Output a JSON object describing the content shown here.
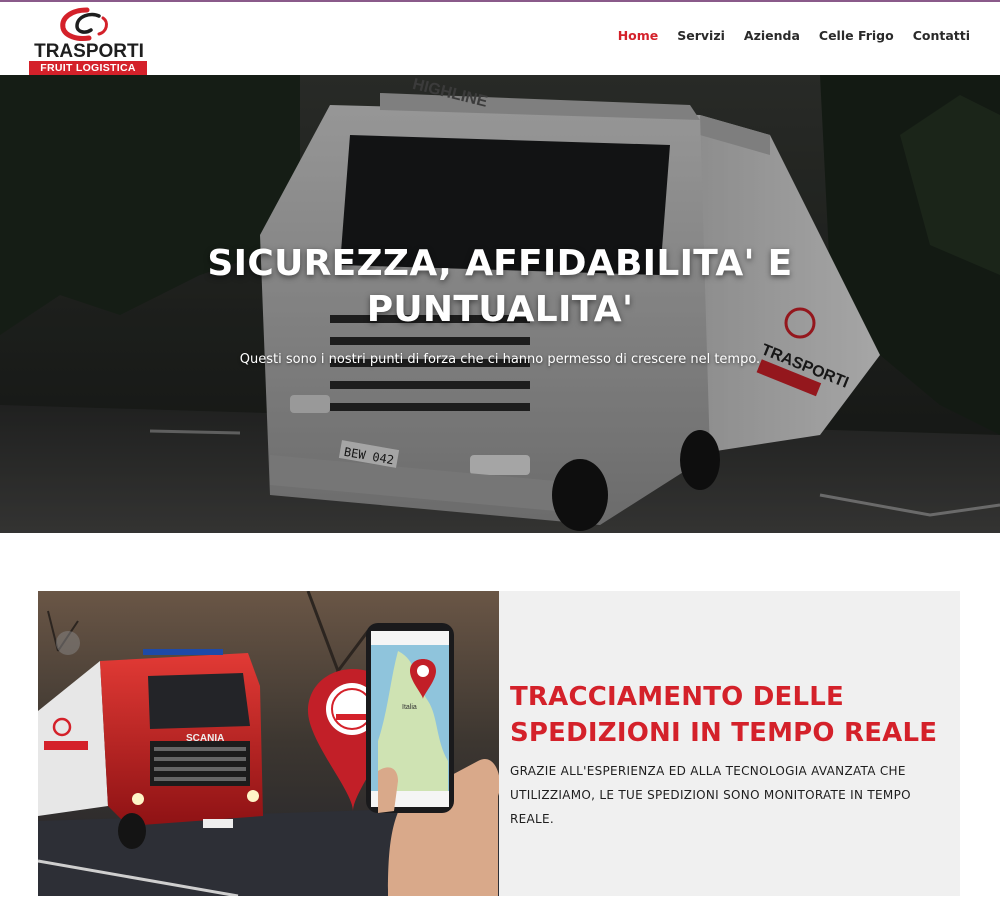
{
  "logo": {
    "wordmark": "TRASPORTI",
    "tagline": "FRUIT LOGISTICA"
  },
  "nav": {
    "items": [
      {
        "label": "Home",
        "active": true
      },
      {
        "label": "Servizi",
        "active": false
      },
      {
        "label": "Azienda",
        "active": false
      },
      {
        "label": "Celle Frigo",
        "active": false
      },
      {
        "label": "Contatti",
        "active": false
      }
    ]
  },
  "hero": {
    "title": "SICUREZZA, AFFIDABILITA' E PUNTUALITA'",
    "subtitle": "Questi sono i nostri punti di forza che ci hanno permesso di crescere nel tempo.",
    "truck_visor_text": "HIGHLINE",
    "truck_plate": "BEW 042"
  },
  "feature": {
    "title": "TRACCIAMENTO DELLE SPEDIZIONI IN TEMPO REALE",
    "text": "Grazie all'esperienza ed alla tecnologia avanzata che utilizziamo, le tue spedizioni sono monitorate in tempo reale.",
    "map_label": "Italia",
    "truck_brand": "SCANIA"
  },
  "colors": {
    "accent": "#d4212a",
    "nav_text": "#2a2a2a",
    "feature_bg": "#f0f0f0"
  }
}
